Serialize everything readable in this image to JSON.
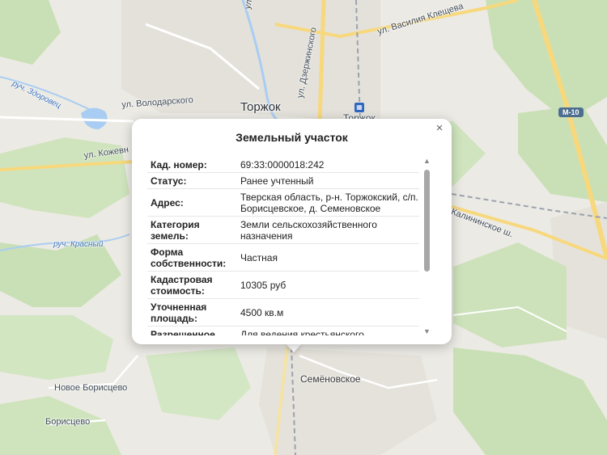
{
  "map": {
    "labels": {
      "city": "Торжок",
      "station": "Торжок",
      "village_main": "Семёновское",
      "village_nb": "Новое Борисцево",
      "village_b": "Борисцево",
      "st_lunacharsky": "ул. Луначарского",
      "st_dzerzhinsky": "ул. Дзержинского",
      "st_kleshneva": "ул. Василия Клещева",
      "st_volodarsky": "ул. Володарского",
      "st_kozhevnikov": "ул. Кожевн",
      "kalininskoe": "Калининское ш.",
      "stream_zdorovets": "руч. Здоровец",
      "stream_krasny": "руч. Красный",
      "road_badge": "М-10"
    },
    "colors": {
      "background": "#eceae4",
      "forest": "#c9e0b6",
      "water": "#a9cdf2",
      "road_major": "#f7d87c",
      "road_minor": "#ffffff"
    }
  },
  "popup": {
    "title": "Земельный участок",
    "close_label": "×",
    "rows": [
      {
        "key": "Кад. номер:",
        "value": "69:33:0000018:242"
      },
      {
        "key": "Статус:",
        "value": "Ранее учтенный"
      },
      {
        "key": "Адрес:",
        "value": "Тверская область, р-н. Торжокский, с/п. Борисцевское, д. Семеновское"
      },
      {
        "key": "Категория земель:",
        "value": "Земли сельскохозяйственного назначения"
      },
      {
        "key": "Форма собственности:",
        "value": "Частная"
      },
      {
        "key": "Кадастровая стоимость:",
        "value": "10305 руб"
      },
      {
        "key": "Уточненная площадь:",
        "value": "4500 кв.м"
      },
      {
        "key": "Разрешенное",
        "value": "Для ведения крестьянского"
      }
    ]
  }
}
